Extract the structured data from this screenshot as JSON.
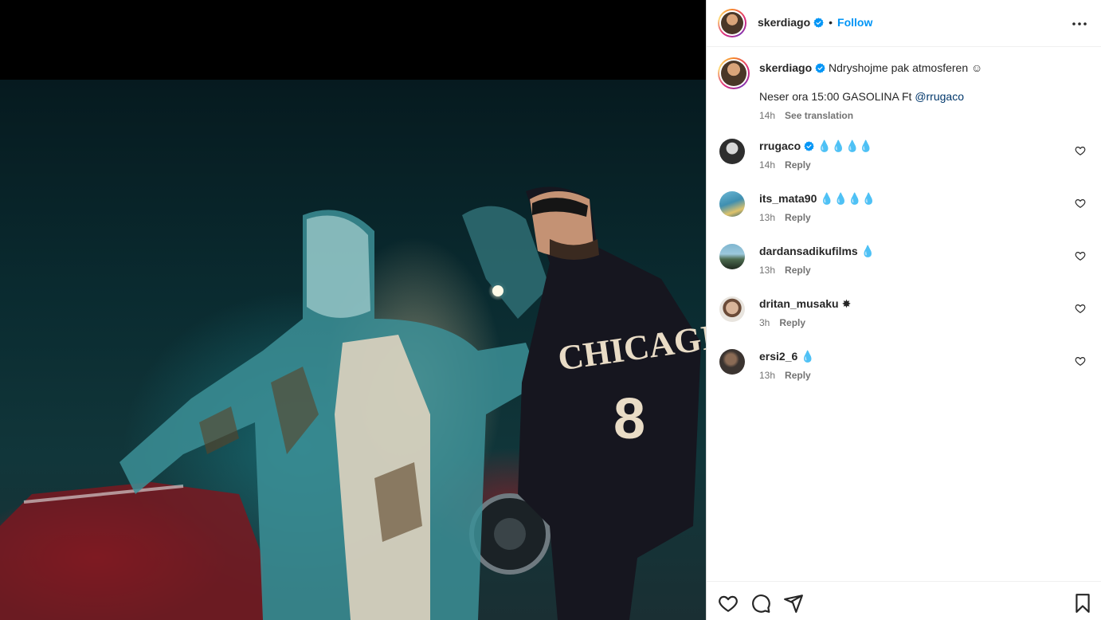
{
  "post": {
    "author": "skerdiago",
    "follow_label": "Follow",
    "separator": "•",
    "media_description_icon": "photo"
  },
  "caption": {
    "username": "skerdiago",
    "text": "Ndryshojme pak atmosferen ☺",
    "line2_prefix": "Neser ora 15:00 GASOLINA Ft ",
    "line2_mention": "@rrugaco",
    "time": "14h",
    "see_translation": "See translation"
  },
  "comments": [
    {
      "username": "rrugaco",
      "verified": true,
      "text": "💧💧💧💧",
      "time": "14h",
      "reply": "Reply",
      "avatar_color": "#5a5a5a"
    },
    {
      "username": "its_mata90",
      "verified": false,
      "text": "💧💧💧💧",
      "time": "13h",
      "reply": "Reply",
      "avatar_color": "#3f8fb0"
    },
    {
      "username": "dardansadikufilms",
      "verified": false,
      "text": "💧",
      "time": "13h",
      "reply": "Reply",
      "avatar_color": "#4c6b4f"
    },
    {
      "username": "dritan_musaku",
      "verified": false,
      "text": "✸",
      "time": "3h",
      "reply": "Reply",
      "avatar_color": "#c9c4bd"
    },
    {
      "username": "ersi2_6",
      "verified": false,
      "text": "💧",
      "time": "13h",
      "reply": "Reply",
      "avatar_color": "#3b3430"
    }
  ],
  "colors": {
    "accent": "#0095f6",
    "verified": "#0095f6",
    "mention": "#00376b",
    "muted": "#737373"
  },
  "icons": {
    "like": "heart-icon",
    "comment": "comment-icon",
    "share": "share-icon",
    "save": "bookmark-icon",
    "more": "more-icon"
  }
}
